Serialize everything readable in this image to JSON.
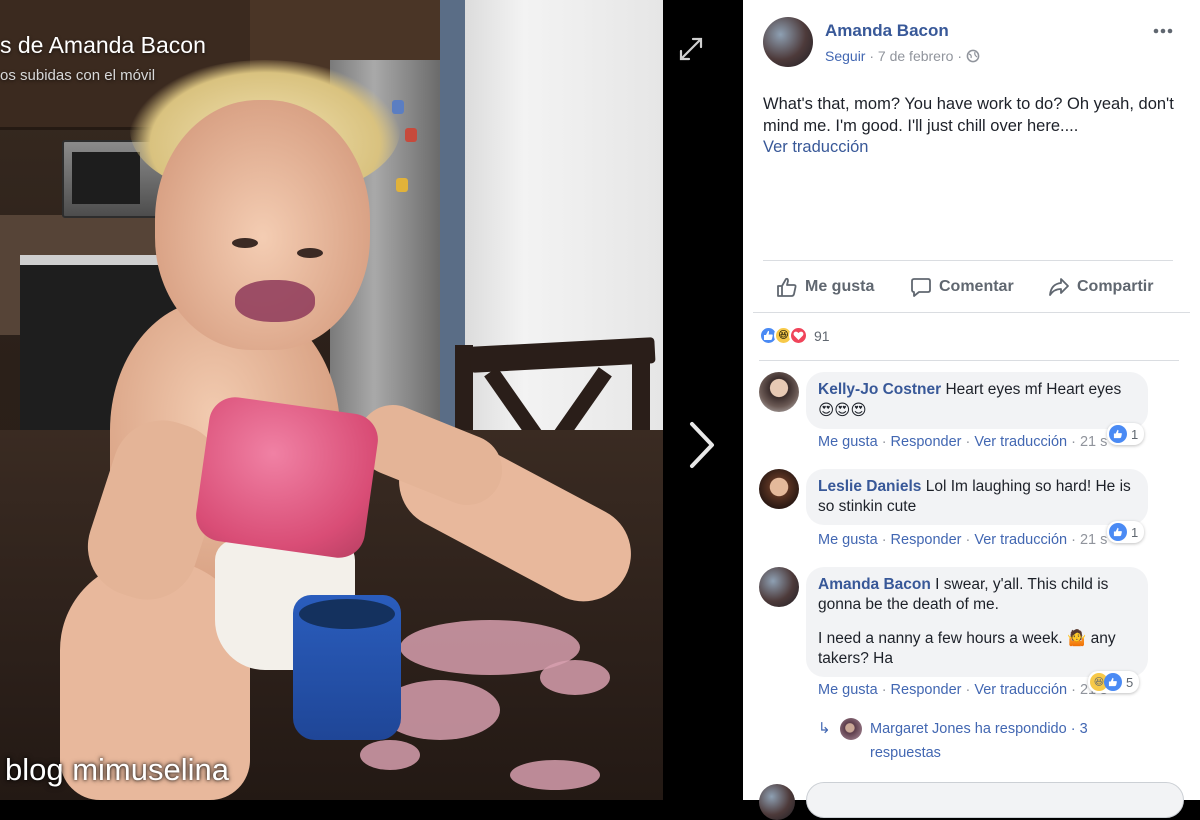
{
  "photo": {
    "album_title": "s de Amanda Bacon",
    "album_subtitle": "os subidas con el móvil",
    "watermark": "blog mimuselina"
  },
  "post": {
    "author": "Amanda Bacon",
    "follow_label": "Seguir",
    "date": "7 de febrero",
    "visibility_icon": "globe-icon",
    "text": "What's that, mom? You have work to do? Oh yeah, don't mind me. I'm good. I'll just chill over here....",
    "translate_label": "Ver traducción"
  },
  "actions": {
    "like": "Me gusta",
    "comment": "Comentar",
    "share": "Compartir"
  },
  "reactions": {
    "types": [
      "like",
      "haha",
      "love"
    ],
    "count": "91"
  },
  "comment_actions": {
    "like": "Me gusta",
    "reply": "Responder",
    "translate": "Ver traducción"
  },
  "comments": [
    {
      "author": "Kelly-Jo Costner",
      "text": "Heart eyes mf Heart eyes",
      "emoji": "😍😍😍",
      "time": "21 s",
      "reaction_count": "1"
    },
    {
      "author": "Leslie Daniels",
      "text": "Lol Im laughing so hard! He is so stinkin cute",
      "time": "21 s",
      "reaction_count": "1"
    },
    {
      "author": "Amanda Bacon",
      "text": "I swear, y'all. This child is gonna be the death of me.",
      "text2_a": "I need a nanny a few hours a week.",
      "text2_emoji": "🤷",
      "text2_b": "any takers? Ha",
      "time": "21 s",
      "reaction_count": "5"
    }
  ],
  "replies": {
    "text": "Margaret Jones ha respondido · 3 respuestas"
  },
  "colors": {
    "link": "#385898",
    "accent": "#4267b2",
    "meta": "#90949c",
    "bubble": "#f2f3f5"
  }
}
